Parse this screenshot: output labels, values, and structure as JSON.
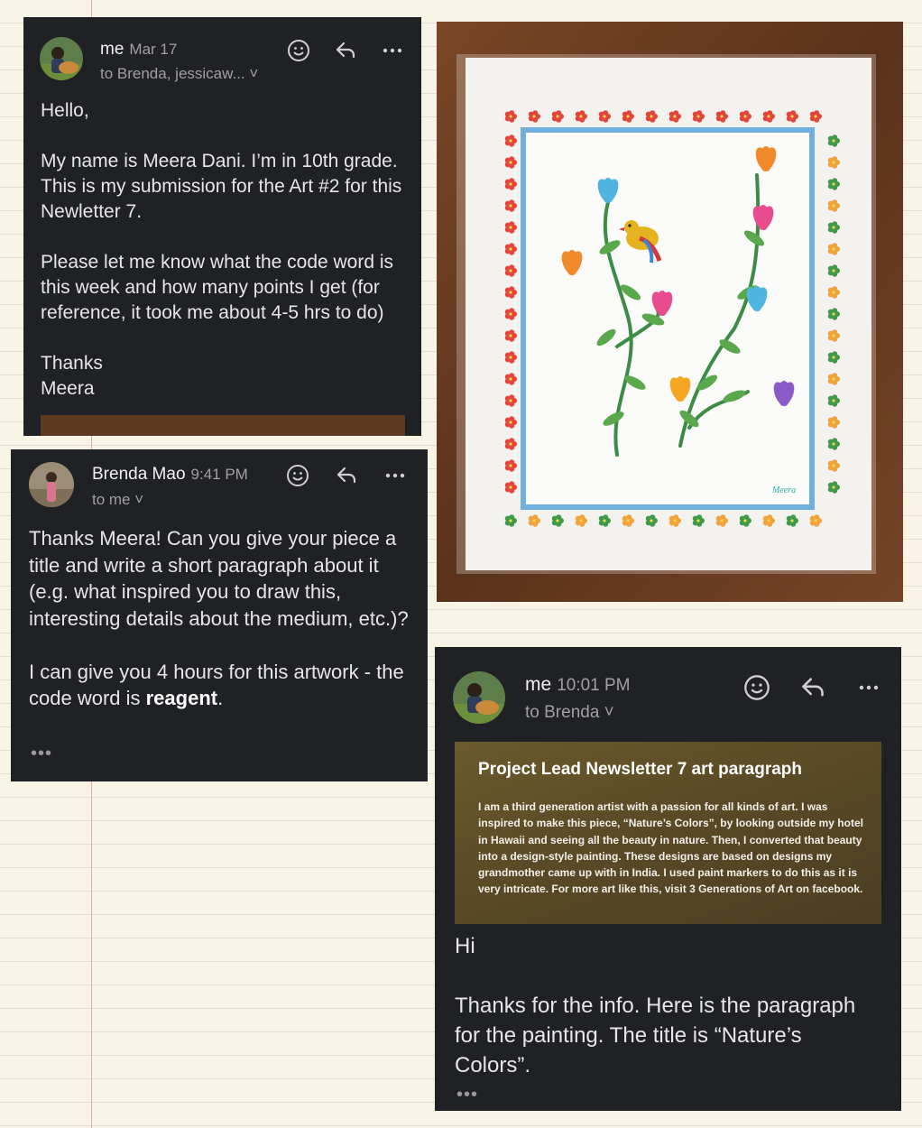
{
  "mail1": {
    "sender": "me",
    "time": "Mar 17",
    "to": "to Brenda, jessicaw... ˅",
    "body": "Hello,\n\nMy name is Meera Dani. I’m in 10th grade. This is my submission for the Art #2 for this Newletter 7.\n\nPlease let me know what the code word is this week and how many points I get (for reference, it took me about 4-5 hrs to do)\n\nThanks\nMeera"
  },
  "mail2": {
    "sender": "Brenda Mao",
    "time": "9:41 PM",
    "to": "to me ˅",
    "body_part1": "Thanks Meera! Can you give your piece a title and write a short paragraph about it (e.g. what inspired you to draw this, interesting details about the medium, etc.)?\n\nI can give you 4 hours for this artwork - the code word is ",
    "body_code": "reagent",
    "body_end": ".",
    "more": "•••"
  },
  "mail3": {
    "sender": "me",
    "time": "10:01 PM",
    "to": "to Brenda ˅",
    "attachment_title": "Project Lead Newsletter 7 art paragraph",
    "attachment_text_1": "I am a third generation artist with a passion for all kinds of art. I was inspired to make this piece, “Nature’s Colors”, by looking outside my hotel in Hawaii and seeing all the beauty in nature. Then, I converted that beauty into a design-style painting. These designs are based on designs my grandmother came up with in India. I used paint markers to do this as it is very intricate. For more art like this, visit ",
    "attachment_text_bold": "3 Generations of Art",
    "attachment_text_2": " on facebook.",
    "body": "Hi\n\nThanks for the info. Here is the paragraph for the painting. The title is “Nature’s Colors”.",
    "more": "•••"
  },
  "painting": {
    "signature": "Meera"
  }
}
